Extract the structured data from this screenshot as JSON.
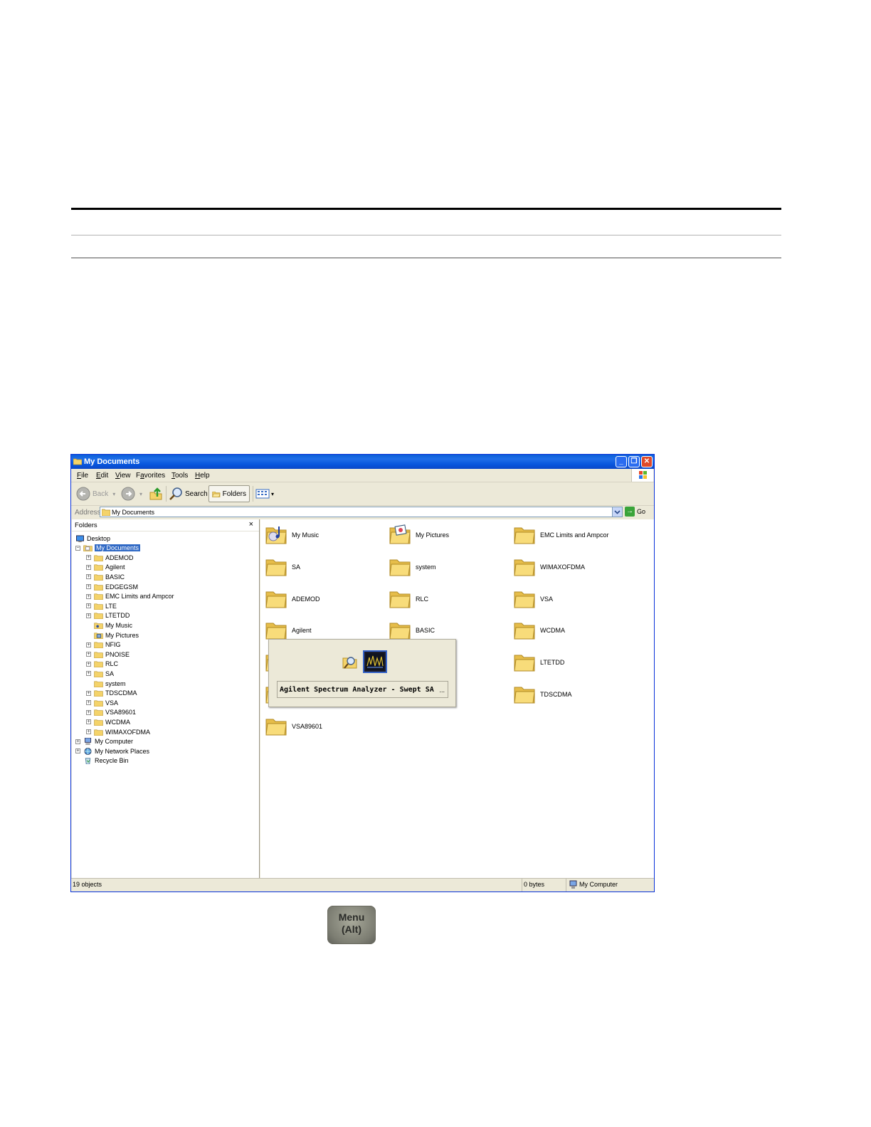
{
  "window": {
    "title": "My Documents",
    "menu": [
      "File",
      "Edit",
      "View",
      "Favorites",
      "Tools",
      "Help"
    ],
    "menu_underline": [
      "F",
      "E",
      "V",
      "a",
      "T",
      "H"
    ],
    "toolbar": {
      "back_label": "Back",
      "search_label": "Search",
      "folders_label": "Folders"
    },
    "address": {
      "label": "Address",
      "value": "My Documents",
      "go_label": "Go"
    }
  },
  "folders_pane": {
    "title": "Folders",
    "close_glyph": "×",
    "tree": [
      {
        "label": "Desktop",
        "icon": "desktop-icon",
        "level": 0,
        "expander": ""
      },
      {
        "label": "My Documents",
        "icon": "my-documents-icon",
        "level": 0,
        "expander": "−",
        "selected": true
      },
      {
        "label": "ADEMOD",
        "icon": "folder-icon",
        "level": 1,
        "expander": "+"
      },
      {
        "label": "Agilent",
        "icon": "folder-icon",
        "level": 1,
        "expander": "+"
      },
      {
        "label": "BASIC",
        "icon": "folder-icon",
        "level": 1,
        "expander": "+"
      },
      {
        "label": "EDGEGSM",
        "icon": "folder-icon",
        "level": 1,
        "expander": "+"
      },
      {
        "label": "EMC Limits and Ampcor",
        "icon": "folder-icon",
        "level": 1,
        "expander": "+"
      },
      {
        "label": "LTE",
        "icon": "folder-icon",
        "level": 1,
        "expander": "+"
      },
      {
        "label": "LTETDD",
        "icon": "folder-icon",
        "level": 1,
        "expander": "+"
      },
      {
        "label": "My Music",
        "icon": "music-folder-icon",
        "level": 1,
        "expander": ""
      },
      {
        "label": "My Pictures",
        "icon": "pictures-folder-icon",
        "level": 1,
        "expander": ""
      },
      {
        "label": "NFIG",
        "icon": "folder-icon",
        "level": 1,
        "expander": "+"
      },
      {
        "label": "PNOISE",
        "icon": "folder-icon",
        "level": 1,
        "expander": "+"
      },
      {
        "label": "RLC",
        "icon": "folder-icon",
        "level": 1,
        "expander": "+"
      },
      {
        "label": "SA",
        "icon": "folder-icon",
        "level": 1,
        "expander": "+"
      },
      {
        "label": "system",
        "icon": "folder-icon",
        "level": 1,
        "expander": ""
      },
      {
        "label": "TDSCDMA",
        "icon": "folder-icon",
        "level": 1,
        "expander": "+"
      },
      {
        "label": "VSA",
        "icon": "folder-icon",
        "level": 1,
        "expander": "+"
      },
      {
        "label": "VSA89601",
        "icon": "folder-icon",
        "level": 1,
        "expander": "+"
      },
      {
        "label": "WCDMA",
        "icon": "folder-icon",
        "level": 1,
        "expander": "+"
      },
      {
        "label": "WIMAXOFDMA",
        "icon": "folder-icon",
        "level": 1,
        "expander": "+"
      },
      {
        "label": "My Computer",
        "icon": "computer-icon",
        "level": 0,
        "expander": "+"
      },
      {
        "label": "My Network Places",
        "icon": "network-icon",
        "level": 0,
        "expander": "+"
      },
      {
        "label": "Recycle Bin",
        "icon": "recycle-bin-icon",
        "level": 0,
        "expander": ""
      }
    ]
  },
  "files": [
    {
      "label": "My Music",
      "icon": "music-folder-icon"
    },
    {
      "label": "My Pictures",
      "icon": "pictures-folder-icon"
    },
    {
      "label": "EMC Limits and Ampcor",
      "icon": "folder-icon"
    },
    {
      "label": "SA",
      "icon": "folder-icon"
    },
    {
      "label": "system",
      "icon": "folder-icon"
    },
    {
      "label": "WIMAXOFDMA",
      "icon": "folder-icon"
    },
    {
      "label": "ADEMOD",
      "icon": "folder-icon"
    },
    {
      "label": "RLC",
      "icon": "folder-icon"
    },
    {
      "label": "VSA",
      "icon": "folder-icon"
    },
    {
      "label": "Agilent",
      "icon": "folder-icon"
    },
    {
      "label": "BASIC",
      "icon": "folder-icon"
    },
    {
      "label": "WCDMA",
      "icon": "folder-icon"
    },
    {
      "label": "",
      "icon": "folder-icon"
    },
    {
      "label": "",
      "icon": "folder-icon"
    },
    {
      "label": "LTETDD",
      "icon": "folder-icon"
    },
    {
      "label": "",
      "icon": "folder-icon"
    },
    {
      "label": "",
      "icon": "folder-icon"
    },
    {
      "label": "TDSCDMA",
      "icon": "folder-icon"
    },
    {
      "label": "VSA89601",
      "icon": "folder-icon"
    }
  ],
  "task_switcher": {
    "label": "Agilent Spectrum Analyzer - Swept SA",
    "ellipsis": "..."
  },
  "status_bar": {
    "objects": "19 objects",
    "size": "0 bytes",
    "zone": "My Computer"
  },
  "menu_key": {
    "line1": "Menu",
    "line2": "(Alt)"
  },
  "colors": {
    "titlebar": "#0a5fd8",
    "selection": "#316ac5",
    "folder": "#f4d36a"
  }
}
